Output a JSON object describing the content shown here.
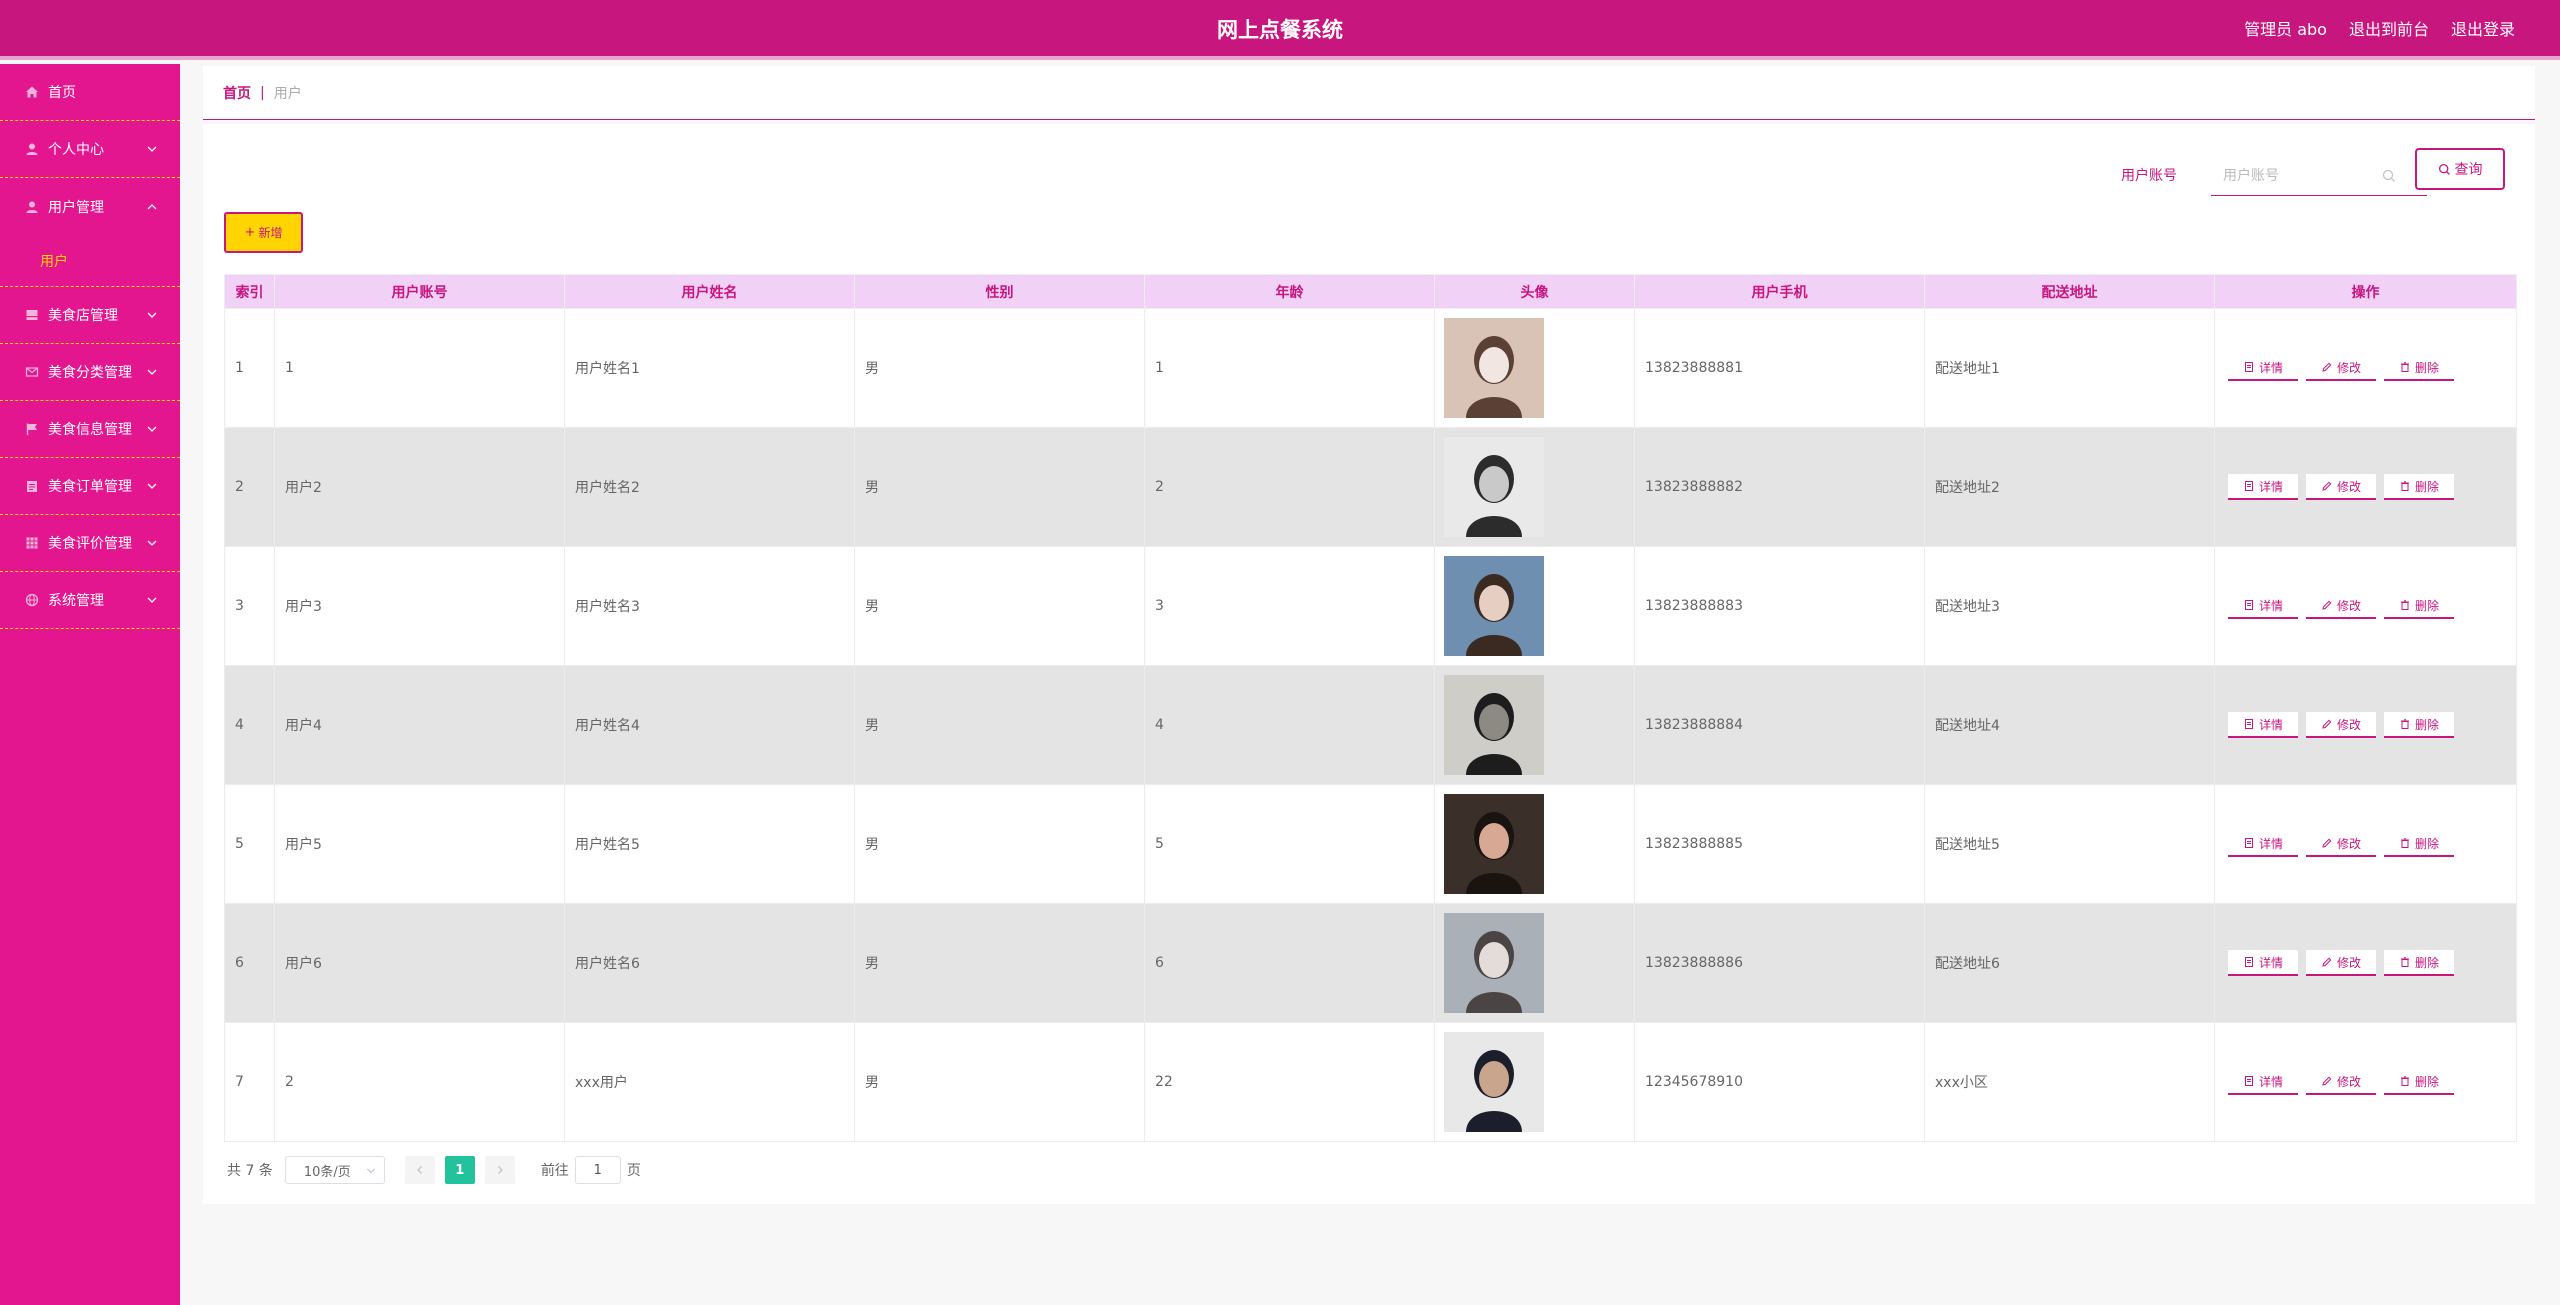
{
  "header": {
    "title": "网上点餐系统",
    "admin": "管理员 abo",
    "back_to_front": "退出到前台",
    "logout": "退出登录"
  },
  "sidebar": {
    "items": [
      {
        "label": "首页",
        "icon": "home-icon"
      },
      {
        "label": "个人中心",
        "icon": "user-icon"
      },
      {
        "label": "用户管理",
        "icon": "user-icon",
        "expanded": true
      },
      {
        "label": "美食店管理",
        "icon": "shop-icon"
      },
      {
        "label": "美食分类管理",
        "icon": "mail-icon"
      },
      {
        "label": "美食信息管理",
        "icon": "flag-icon"
      },
      {
        "label": "美食订单管理",
        "icon": "clipboard-icon"
      },
      {
        "label": "美食评价管理",
        "icon": "grid-icon"
      },
      {
        "label": "系统管理",
        "icon": "globe-icon"
      }
    ],
    "sub_item": "用户"
  },
  "breadcrumb": {
    "home": "首页",
    "separator": "|",
    "current": "用户"
  },
  "search": {
    "label": "用户账号",
    "placeholder": "用户账号",
    "button": "查询"
  },
  "add_button": "新增",
  "table": {
    "headers": [
      "索引",
      "用户账号",
      "用户姓名",
      "性别",
      "年龄",
      "头像",
      "用户手机",
      "配送地址",
      "操作"
    ],
    "rows": [
      {
        "index": "1",
        "account": "1",
        "name": "用户姓名1",
        "gender": "男",
        "age": "1",
        "phone": "13823888881",
        "address": "配送地址1",
        "avatar_colors": [
          "#d9c3b6",
          "#5a4035",
          "#f1e6e1"
        ]
      },
      {
        "index": "2",
        "account": "用户2",
        "name": "用户姓名2",
        "gender": "男",
        "age": "2",
        "phone": "13823888882",
        "address": "配送地址2",
        "avatar_colors": [
          "#e9e9e9",
          "#2c2c2c",
          "#c9c9c9"
        ]
      },
      {
        "index": "3",
        "account": "用户3",
        "name": "用户姓名3",
        "gender": "男",
        "age": "3",
        "phone": "13823888883",
        "address": "配送地址3",
        "avatar_colors": [
          "#6f8fb0",
          "#3a2a22",
          "#e6cfc2"
        ]
      },
      {
        "index": "4",
        "account": "用户4",
        "name": "用户姓名4",
        "gender": "男",
        "age": "4",
        "phone": "13823888884",
        "address": "配送地址4",
        "avatar_colors": [
          "#cfcdc7",
          "#1d1d1d",
          "#8d8a84"
        ]
      },
      {
        "index": "5",
        "account": "用户5",
        "name": "用户姓名5",
        "gender": "男",
        "age": "5",
        "phone": "13823888885",
        "address": "配送地址5",
        "avatar_colors": [
          "#3b2f2a",
          "#1a1410",
          "#d7a894"
        ]
      },
      {
        "index": "6",
        "account": "用户6",
        "name": "用户姓名6",
        "gender": "男",
        "age": "6",
        "phone": "13823888886",
        "address": "配送地址6",
        "avatar_colors": [
          "#a9b0b8",
          "#4a4444",
          "#e4dcd8"
        ]
      },
      {
        "index": "7",
        "account": "2",
        "name": "xxx用户",
        "gender": "男",
        "age": "22",
        "phone": "12345678910",
        "address": "xxx小区",
        "avatar_colors": [
          "#e8e8e8",
          "#1c1f2b",
          "#caa58d"
        ]
      }
    ],
    "actions": {
      "detail": "详情",
      "edit": "修改",
      "delete": "删除"
    }
  },
  "pagination": {
    "total": "共 7 条",
    "page_size": "10条/页",
    "current_page": "1",
    "goto_prefix": "前往",
    "goto_value": "1",
    "goto_suffix": "页"
  },
  "colors": {
    "brand": "#c8167f",
    "sidebar": "#e3168f",
    "accent": "#ffd400",
    "header_row": "#f1d1f6",
    "pager_active": "#22c39c"
  }
}
